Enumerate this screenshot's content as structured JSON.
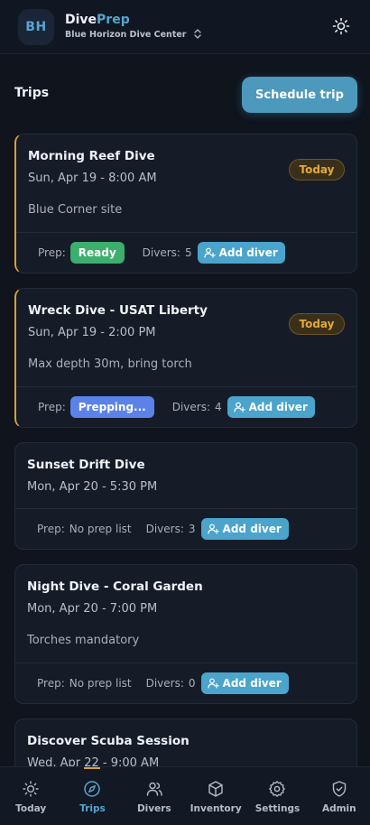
{
  "header": {
    "avatar_initials": "BH",
    "brand_part1": "Dive",
    "brand_part2": "Prep",
    "center_name": "Blue Horizon Dive Center",
    "center_switch_icon": "chevron-up-down-icon",
    "theme_icon": "sun-icon"
  },
  "page": {
    "title": "Trips",
    "schedule_label": "Schedule trip"
  },
  "labels": {
    "prep": "Prep:",
    "divers": "Divers:",
    "add_diver": "Add diver",
    "today": "Today"
  },
  "trips": [
    {
      "title": "Morning Reef Dive",
      "time": "Sun, Apr 19 - 8:00 AM",
      "note": "Blue Corner site",
      "today": true,
      "prep": "Ready",
      "divers": "5"
    },
    {
      "title": "Wreck Dive - USAT Liberty",
      "time": "Sun, Apr 19 - 2:00 PM",
      "note": "Max depth 30m, bring torch",
      "today": true,
      "prep": "Prepping...",
      "divers": "4"
    },
    {
      "title": "Sunset Drift Dive",
      "time": "Mon, Apr 20 - 5:30 PM",
      "note": "",
      "today": false,
      "prep": "No prep list",
      "divers": "3"
    },
    {
      "title": "Night Dive - Coral Garden",
      "time": "Mon, Apr 20 - 7:00 PM",
      "note": "Torches mandatory",
      "today": false,
      "prep": "No prep list",
      "divers": "0"
    },
    {
      "title": "Discover Scuba Session",
      "time": "Wed, Apr 22 - 9:00 AM",
      "note": "",
      "today": false,
      "prep": "",
      "divers": ""
    }
  ],
  "nav": [
    {
      "label": "Today",
      "icon": "sun-icon",
      "active": false
    },
    {
      "label": "Trips",
      "icon": "compass-icon",
      "active": true
    },
    {
      "label": "Divers",
      "icon": "users-icon",
      "active": false
    },
    {
      "label": "Inventory",
      "icon": "box-icon",
      "active": false
    },
    {
      "label": "Settings",
      "icon": "gear-icon",
      "active": false
    },
    {
      "label": "Admin",
      "icon": "shield-check-icon",
      "active": false
    }
  ],
  "colors": {
    "accent": "#57a5cf",
    "today_border": "#d6a23a",
    "ready": "#3cae6d",
    "prepping": "#5a82e8",
    "add_diver": "#4aa4cc"
  }
}
